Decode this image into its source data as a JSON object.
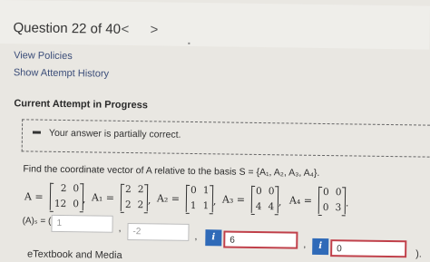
{
  "question": {
    "title": "Question 22 of 40",
    "prev_icon": "chevron-left-icon",
    "next_icon": "chevron-right-icon",
    "prev_glyph": "<",
    "next_glyph": ">"
  },
  "links": {
    "view_policies": "View Policies",
    "show_history": "Show Attempt History"
  },
  "current_attempt": "Current Attempt in Progress",
  "feedback": {
    "icon": "minus-icon",
    "message": "Your answer is partially correct."
  },
  "problem": {
    "prompt": "Find the coordinate vector of A relative to the basis S = {A₁, A₂, A₃, A₄}.",
    "A_label": "A =",
    "A": [
      [
        "2",
        "0"
      ],
      [
        "12",
        "0"
      ]
    ],
    "A1_label": "A₁ =",
    "A1": [
      [
        "2",
        "2"
      ],
      [
        "2",
        "2"
      ]
    ],
    "A2_label": "A₂ =",
    "A2": [
      [
        "0",
        "1"
      ],
      [
        "1",
        "1"
      ]
    ],
    "A3_label": "A₃ =",
    "A3": [
      [
        "0",
        "0"
      ],
      [
        "4",
        "4"
      ]
    ],
    "A4_label": "A₄ =",
    "A4": [
      [
        "0",
        "0"
      ],
      [
        "0",
        "3"
      ]
    ],
    "sep": ",",
    "end": "."
  },
  "answer": {
    "label": "(A)ₛ = (",
    "values": [
      "1",
      "-2",
      "6",
      "0"
    ],
    "info_label": "i",
    "comma": ",",
    "close": ")."
  },
  "etextbook": "eTextbook and Media",
  "colors": {
    "info_button": "#2f6ab8",
    "wrong_border": "#c0404a",
    "link": "#3a4c78"
  }
}
